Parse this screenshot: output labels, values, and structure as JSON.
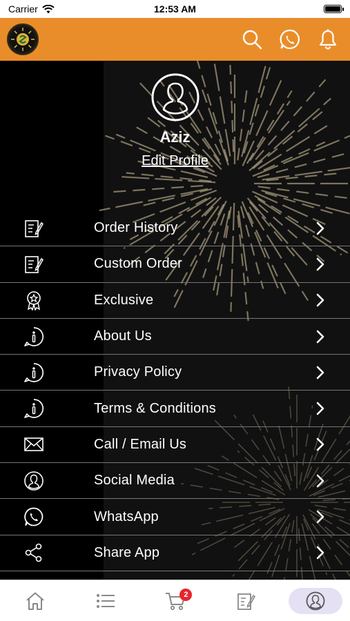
{
  "status_bar": {
    "carrier": "Carrier",
    "time": "12:53 AM"
  },
  "header": {
    "logo": "app-logo",
    "actions": [
      {
        "icon": "search-icon"
      },
      {
        "icon": "whatsapp-icon"
      },
      {
        "icon": "bell-icon"
      }
    ]
  },
  "profile": {
    "name": "Aziz",
    "edit_label": "Edit Profile"
  },
  "menu": [
    {
      "label": "Order History",
      "icon": "order-history-icon"
    },
    {
      "label": "Custom Order",
      "icon": "custom-order-icon"
    },
    {
      "label": "Exclusive",
      "icon": "badge-icon"
    },
    {
      "label": "About Us",
      "icon": "info-icon"
    },
    {
      "label": "Privacy Policy",
      "icon": "info-icon"
    },
    {
      "label": "Terms & Conditions",
      "icon": "info-icon"
    },
    {
      "label": "Call / Email Us",
      "icon": "mail-icon"
    },
    {
      "label": "Social Media",
      "icon": "user-circle-icon"
    },
    {
      "label": "WhatsApp",
      "icon": "whatsapp-icon"
    },
    {
      "label": "Share App",
      "icon": "share-icon"
    }
  ],
  "tabbar": {
    "tabs": [
      {
        "icon": "home-icon"
      },
      {
        "icon": "list-icon"
      },
      {
        "icon": "cart-icon",
        "badge": "2"
      },
      {
        "icon": "order-icon"
      },
      {
        "icon": "profile-icon",
        "active": true
      }
    ]
  },
  "colors": {
    "accent": "#e98d2a",
    "background": "#000000",
    "active_tab": "#e6e0f4",
    "badge": "#e8242b"
  }
}
